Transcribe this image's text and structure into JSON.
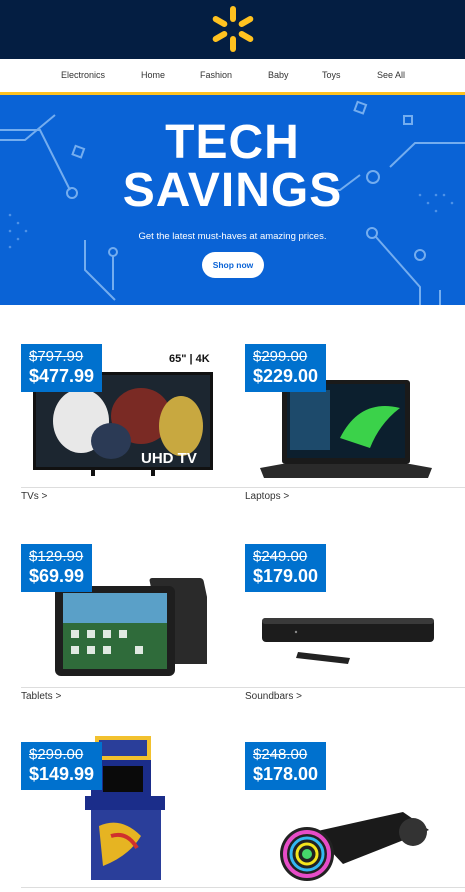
{
  "header": {
    "logo_icon": "walmart-spark-icon",
    "logo_color": "#ffc220",
    "background": "#041e42"
  },
  "nav": {
    "items": [
      {
        "label": "Electronics"
      },
      {
        "label": "Home"
      },
      {
        "label": "Fashion"
      },
      {
        "label": "Baby"
      },
      {
        "label": "Toys"
      },
      {
        "label": "See All"
      }
    ],
    "underline_color": "#ffc220"
  },
  "hero": {
    "title_line1": "TECH",
    "title_line2": "SAVINGS",
    "subtitle": "Get the latest must-haves at amazing prices.",
    "button_label": "Shop now",
    "background": "#0a63d6"
  },
  "products": [
    {
      "was": "$797.99",
      "now": "$477.99",
      "label": "TVs >",
      "image_text_top": "65\" | 4K",
      "image_text_overlay": "UHD TV",
      "icon": "tv-icon"
    },
    {
      "was": "$299.00",
      "now": "$229.00",
      "label": "Laptops >",
      "icon": "laptop-icon"
    },
    {
      "was": "$129.99",
      "now": "$69.99",
      "label": "Tablets >",
      "icon": "tablet-icon"
    },
    {
      "was": "$249.00",
      "now": "$179.00",
      "label": "Soundbars >",
      "icon": "soundbar-icon"
    },
    {
      "was": "$299.00",
      "now": "$149.99",
      "label": "",
      "icon": "arcade-cabinet-icon"
    },
    {
      "was": "$248.00",
      "now": "$178.00",
      "label": "",
      "icon": "hoverboard-icon"
    }
  ],
  "price_tag_color": "#0071ce"
}
